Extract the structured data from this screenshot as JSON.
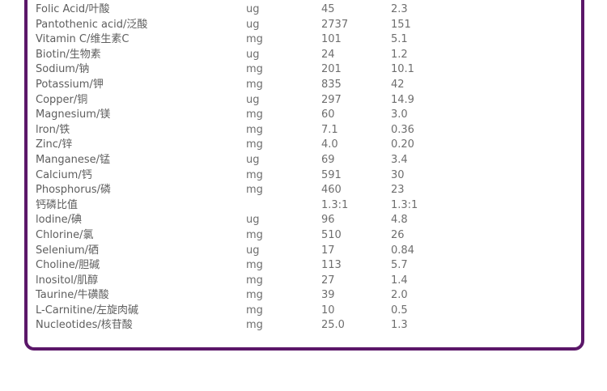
{
  "nutrition": {
    "rows": [
      {
        "name": "Folic Acid/叶酸",
        "unit": "ug",
        "value": "45",
        "percent": "2.3"
      },
      {
        "name": "Pantothenic acid/泛酸",
        "unit": "ug",
        "value": "2737",
        "percent": "151"
      },
      {
        "name": "Vitamin C/维生素C",
        "unit": "mg",
        "value": "101",
        "percent": "5.1"
      },
      {
        "name": "Biotin/生物素",
        "unit": "ug",
        "value": "24",
        "percent": "1.2"
      },
      {
        "name": "Sodium/钠",
        "unit": "mg",
        "value": "201",
        "percent": "10.1"
      },
      {
        "name": "Potassium/钾",
        "unit": "mg",
        "value": "835",
        "percent": "42"
      },
      {
        "name": "Copper/铜",
        "unit": "ug",
        "value": "297",
        "percent": "14.9"
      },
      {
        "name": "Magnesium/镁",
        "unit": "mg",
        "value": "60",
        "percent": "3.0"
      },
      {
        "name": "lron/铁",
        "unit": "mg",
        "value": "7.1",
        "percent": "0.36"
      },
      {
        "name": "Zinc/锌",
        "unit": "mg",
        "value": "4.0",
        "percent": "0.20"
      },
      {
        "name": "Manganese/锰",
        "unit": "ug",
        "value": "69",
        "percent": "3.4"
      },
      {
        "name": "Calcium/钙",
        "unit": "mg",
        "value": "591",
        "percent": "30"
      },
      {
        "name": "Phosphorus/磷",
        "unit": "mg",
        "value": "460",
        "percent": "23"
      },
      {
        "name": "钙磷比值",
        "unit": "",
        "value": "1.3:1",
        "percent": "1.3:1"
      },
      {
        "name": "lodine/碘",
        "unit": "ug",
        "value": "96",
        "percent": "4.8"
      },
      {
        "name": "Chlorine/氯",
        "unit": "mg",
        "value": "510",
        "percent": "26"
      },
      {
        "name": "Selenium/硒",
        "unit": "ug",
        "value": "17",
        "percent": "0.84"
      },
      {
        "name": "Choline/胆碱",
        "unit": "mg",
        "value": "113",
        "percent": "5.7"
      },
      {
        "name": "lnositol/肌醇",
        "unit": "mg",
        "value": "27",
        "percent": "1.4"
      },
      {
        "name": "Taurine/牛磺酸",
        "unit": "mg",
        "value": "39",
        "percent": "2.0"
      },
      {
        "name": "L-Carnitine/左旋肉碱",
        "unit": "mg",
        "value": "10",
        "percent": "0.5"
      },
      {
        "name": "Nucleotides/核苷酸",
        "unit": "mg",
        "value": "25.0",
        "percent": "1.3"
      }
    ]
  },
  "colors": {
    "border": "#5b1769",
    "text": "#6e6e6e"
  }
}
